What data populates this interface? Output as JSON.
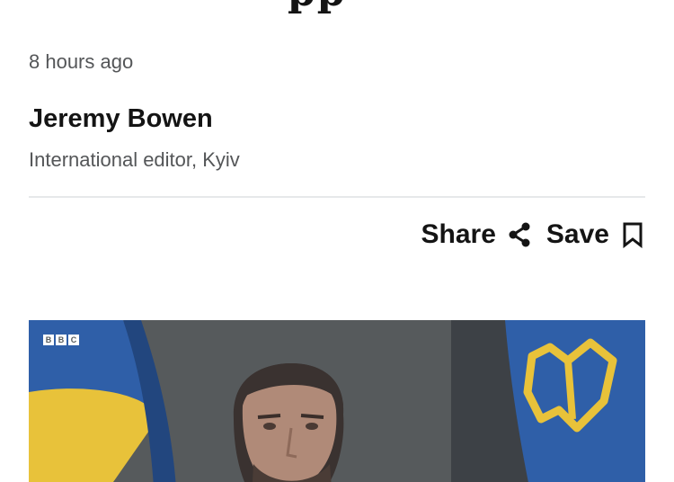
{
  "headline": {
    "visible_fragment": "pp"
  },
  "byline": {
    "timestamp": "8 hours ago",
    "author_name": "Jeremy Bowen",
    "author_role": "International editor, Kyiv"
  },
  "actions": {
    "share_label": "Share",
    "share_icon": "share-icon",
    "save_label": "Save",
    "save_icon": "bookmark-icon"
  },
  "media": {
    "logo_letters": [
      "B",
      "B",
      "C"
    ],
    "image_subject": "video still",
    "colors": {
      "background": "#565a5c",
      "flag_blue": "#2f5fa8",
      "flag_yellow": "#e8c23a"
    }
  }
}
